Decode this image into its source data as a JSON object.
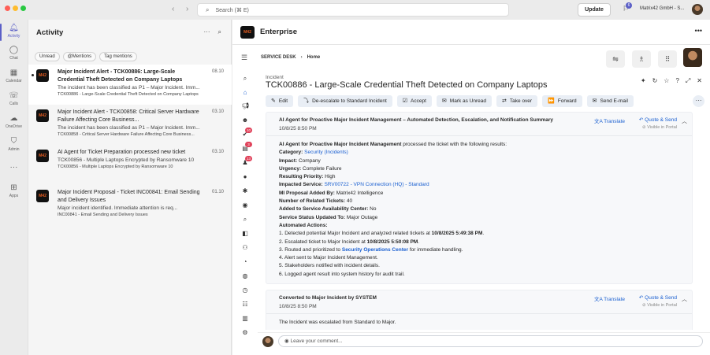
{
  "window": {
    "search_placeholder": "Search (⌘ E)",
    "update_label": "Update",
    "notif_count": "6",
    "org_name": "Matrix42 GmbH - S..."
  },
  "rail": [
    {
      "label": "Activity",
      "icon": "bell-icon"
    },
    {
      "label": "Chat",
      "icon": "chat-icon"
    },
    {
      "label": "Calendar",
      "icon": "calendar-icon"
    },
    {
      "label": "Calls",
      "icon": "phone-icon"
    },
    {
      "label": "OneDrive",
      "icon": "cloud-icon"
    },
    {
      "label": "Admin",
      "icon": "shield-icon"
    },
    {
      "label": "Apps",
      "icon": "plus-icon"
    }
  ],
  "activity": {
    "title": "Activity",
    "filters": [
      "Unread",
      "@Mentions",
      "Tag mentions"
    ],
    "items": [
      {
        "title": "Major Incident Alert - TCK00886: Large-Scale Credential Theft Detected on Company Laptops",
        "time": "08.10",
        "preview": "The incident has been classified as P1 – Major Incident. Imm...",
        "sub": "TCK00886 - Large-Scale Credential Theft Detected on Company Laptops"
      },
      {
        "title": "Major Incident Alert - TCK00858: Critical Server Hardware Failure Affecting Core Business...",
        "time": "03.10",
        "preview": "The incident has been classified as P1 – Major Incident. Imm...",
        "sub": "TCK00858 - Critical Server Hardware Failure Affecting Core Business..."
      },
      {
        "title": "AI Agent for Ticket Preparation processed new ticket",
        "time": "03.10",
        "preview": "TCK00856 - Multiple Laptops Encrypted by Ransomware 10",
        "sub": "TCK00856 - Multiple Laptops Encrypted by Ransomware 10"
      },
      {
        "title": "Major Incident Proposal - Ticket INC00841: Email Sending and Delivery Issues",
        "time": "01.10",
        "preview": "Major incident identified. Immediate attention is req...",
        "sub": "INC00841 - Email Sending and Delivery Issues"
      }
    ]
  },
  "app": {
    "logo_text": "M42",
    "name": "Enterprise",
    "breadcrumb": [
      "SERVICE DESK",
      "Home"
    ],
    "side_badges": [
      "10",
      "3",
      "13"
    ],
    "incident_label": "Incident",
    "incident_title": "TCK00886 - Large-Scale Credential Theft Detected on Company Laptops",
    "actions": [
      {
        "label": "Edit",
        "icon": "✎"
      },
      {
        "label": "De-escalate to Standard Incident",
        "icon": "⤵"
      },
      {
        "label": "Accept",
        "icon": "☑"
      },
      {
        "label": "Mark as Unread",
        "icon": "✉"
      },
      {
        "label": "Take over",
        "icon": "⇄"
      },
      {
        "label": "Forward",
        "icon": "⏩"
      },
      {
        "label": "Send E-mail",
        "icon": "✉"
      }
    ],
    "card1": {
      "title": "AI Agent for Proactive Major Incident Management – Automated Detection, Escalation, and Notification Summary",
      "date": "10/8/25 8:50 PM",
      "translate": "Translate",
      "quote_send": "Quote & Send",
      "visible": "Visible in Portal",
      "intro_bold": "AI Agent for Proactive Major Incident Management",
      "intro_rest": " processed the ticket with the following results:",
      "category_label": "Category:",
      "category_value": "Security (Incidents)",
      "impact_label": "Impact:",
      "impact_value": "Company",
      "urgency_label": "Urgency:",
      "urgency_value": "Complete Failure",
      "priority_label": "Resulting Priority:",
      "priority_value": "High",
      "service_label": "Impacted Service:",
      "service_value": "SRV00722 - VPN Connection (HQ) - Standard",
      "proposal_label": "MI Proposal Added By:",
      "proposal_value": "Matrix42 Intelligence",
      "related_label": "Number of Related Tickets:",
      "related_value": "40",
      "avail_label": "Added to Service Availability Center:",
      "avail_value": "No",
      "status_label": "Service Status Updated To:",
      "status_value": "Major Outage",
      "actions_label": "Automated Actions:",
      "a1_pre": "1. Detected potential Major Incident and analyzed related tickets at ",
      "a1_time": "10/8/2025 5:49:38 PM",
      "a2_pre": "2. Escalated ticket to Major Incident at ",
      "a2_time": "10/8/2025 5:50:08 PM",
      "a3_pre": "3. Routed and prioritized to ",
      "a3_link": "Security Operations Center",
      "a3_post": " for immediate handling.",
      "a4": "4. Alert sent to Major Incident Management.",
      "a5": "5. Stakeholders notified with incident details.",
      "a6": "6. Logged agent result into system history for audit trail."
    },
    "card2": {
      "title": "Converted to Major Incident by SYSTEM",
      "date": "10/8/25 8:50 PM",
      "translate": "Translate",
      "quote_send": "Quote & Send",
      "visible": "Visible in Portal",
      "body": "The Incident was escalated from Standard to Major."
    },
    "comment_placeholder": "Leave your comment..."
  },
  "colors": {
    "accent": "#5b5fc7",
    "link": "#1a5fd0",
    "badge": "#e0425a"
  }
}
